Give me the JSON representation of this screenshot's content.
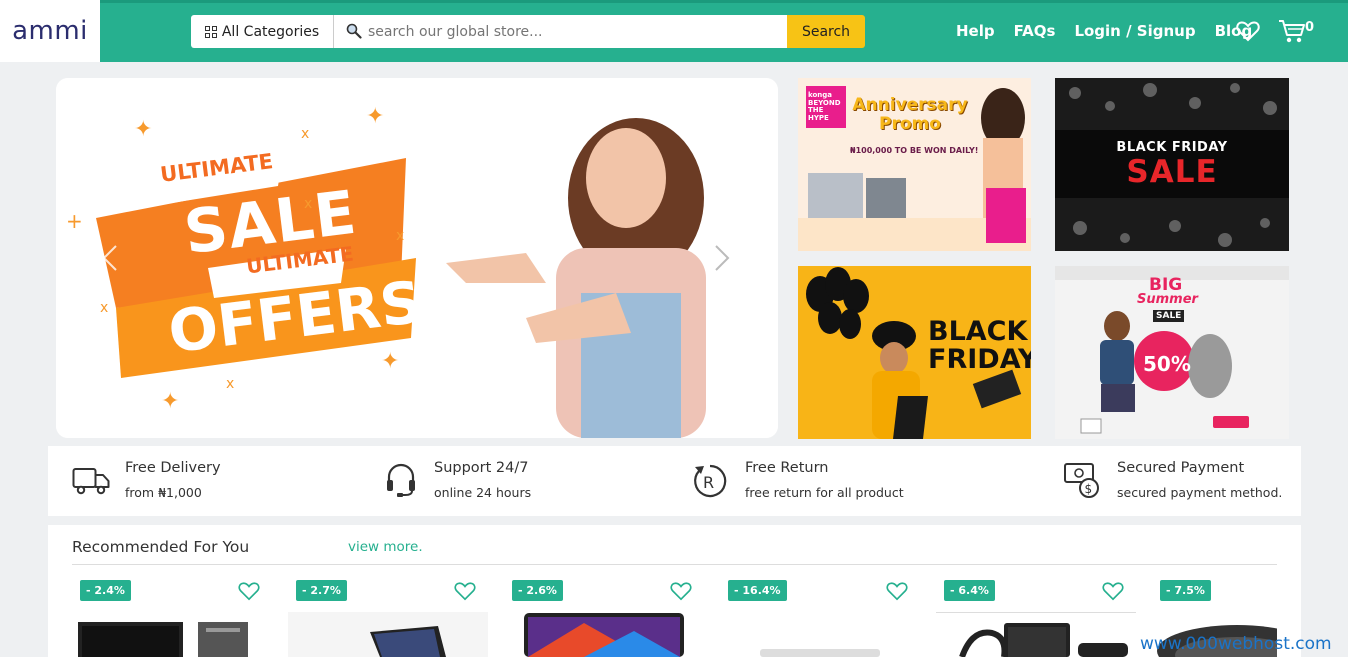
{
  "header": {
    "logo": "ammi",
    "category_label": "All Categories",
    "search_placeholder": "search our global store...",
    "search_button": "Search",
    "nav": [
      "Help",
      "FAQs",
      "Login / Signup",
      "Blog"
    ],
    "cart_count": "0"
  },
  "hero": {
    "line1": "ULTIMATE",
    "line2": "SALE",
    "line3": "ULTIMATE",
    "line4": "OFFERS"
  },
  "promos": {
    "p1_brand": "konga BEYOND THE HYPE",
    "p1_title": "Anniversary Promo",
    "p1_sub": "₦100,000 TO BE WON DAILY!",
    "p2_title1": "BLACK FRIDAY",
    "p2_title2": "SALE",
    "p3_title": "BLACK FRIDAY",
    "p4_title1": "BIG",
    "p4_title2": "Summer",
    "p4_sale": "SALE",
    "p4_pct": "50%"
  },
  "features": [
    {
      "title": "Free Delivery",
      "sub": "from ₦1,000"
    },
    {
      "title": "Support 24/7",
      "sub": "online 24 hours"
    },
    {
      "title": "Free Return",
      "sub": "free return for all product"
    },
    {
      "title": "Secured Payment",
      "sub": "secured payment method."
    }
  ],
  "recommended": {
    "title": "Recommended For You",
    "more": "view more.",
    "discounts": [
      "- 2.4%",
      "- 2.7%",
      "- 2.6%",
      "- 16.4%",
      "- 6.4%",
      "- 7.5%"
    ]
  },
  "watermark": "www.000webhost.com",
  "colors": {
    "brand": "#26b08f",
    "accent": "#f7c315",
    "logo": "#2b2d6e"
  }
}
